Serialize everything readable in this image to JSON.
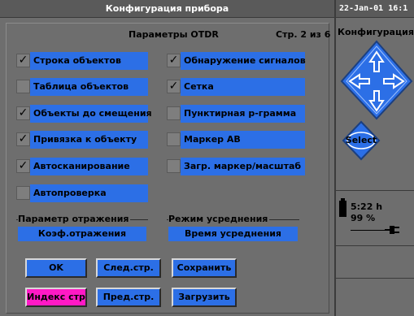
{
  "window": {
    "title": "Конфигурация прибора",
    "clock": "22-Jan-01 16:1"
  },
  "page": {
    "header": "Параметры OTDR",
    "page_num": "Стр. 2 из 6"
  },
  "options_left": [
    {
      "label": "Строка объектов",
      "checked": true
    },
    {
      "label": "Таблица объектов",
      "checked": false
    },
    {
      "label": "Объекты до смещения",
      "checked": true
    },
    {
      "label": "Привязка к объекту",
      "checked": true
    },
    {
      "label": "Автосканирование",
      "checked": true
    },
    {
      "label": "Автопроверка",
      "checked": false
    }
  ],
  "options_right": [
    {
      "label": "Обнаружение сигналов",
      "checked": true
    },
    {
      "label": "Сетка",
      "checked": true
    },
    {
      "label": "Пунктирная р-грамма",
      "checked": false
    },
    {
      "label": "Маркер АВ",
      "checked": false
    },
    {
      "label": "Загр. маркер/масштаб",
      "checked": false
    }
  ],
  "groups": {
    "reflection": {
      "title": "Параметр отражения",
      "value": "Коэф.отражения"
    },
    "averaging": {
      "title": "Режим усреднения",
      "value": "Время усреднения"
    }
  },
  "buttons": {
    "ok": "OK",
    "next_page": "След.стр.",
    "save": "Сохранить",
    "page_index": "Индекс стр",
    "prev_page": "Пред.стр.",
    "load": "Загрузить"
  },
  "sidebar": {
    "title": "Конфигурация",
    "select": "Select",
    "battery_time": "5:22 h",
    "battery_pct": "99 %"
  },
  "colors": {
    "field": "#2c6fe6",
    "accent": "#ff19c5",
    "background": "#6e6e6e"
  }
}
